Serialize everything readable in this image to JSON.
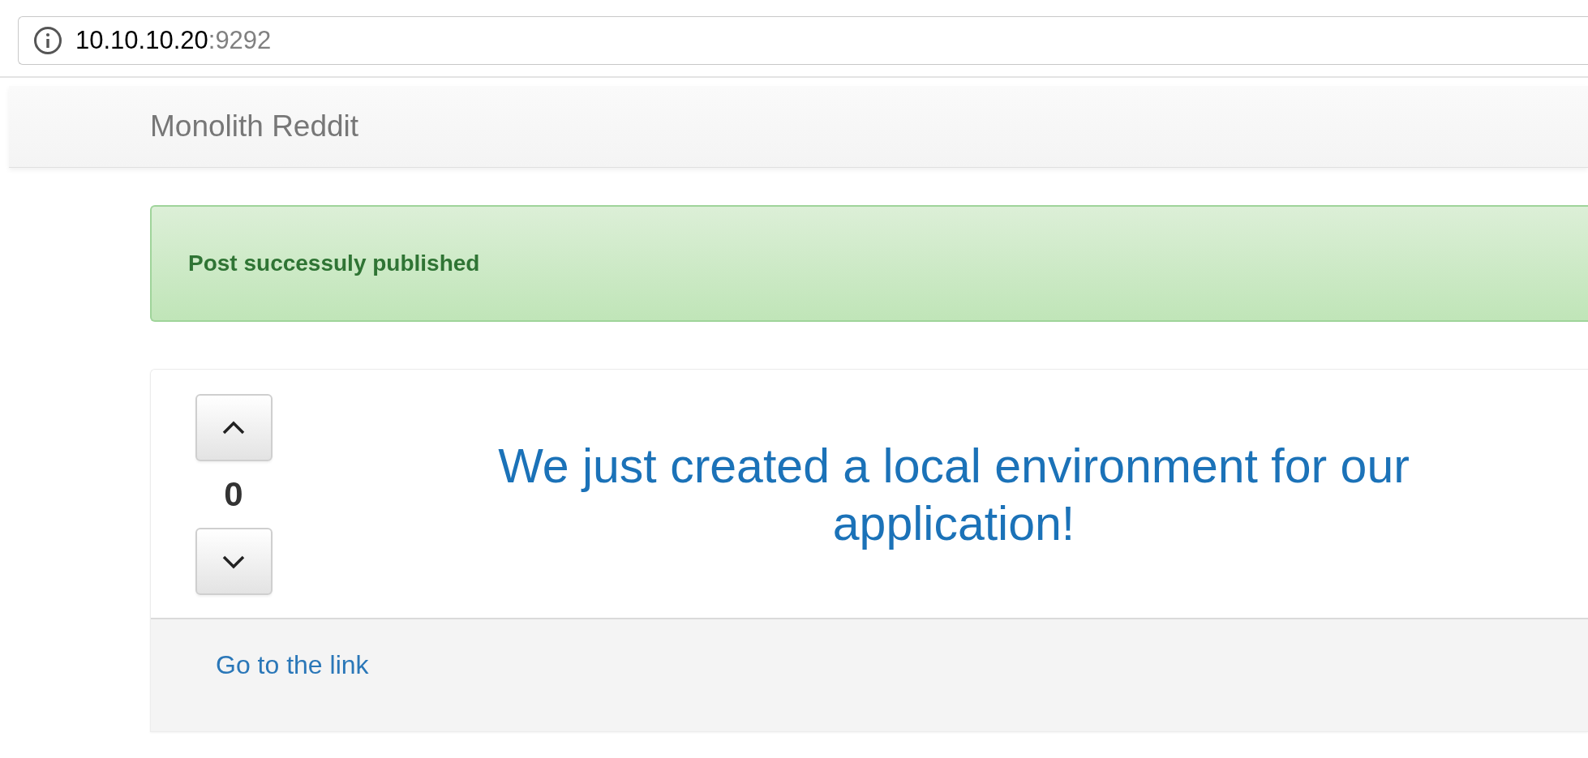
{
  "address_bar": {
    "host": "10.10.10.20",
    "port": ":9292"
  },
  "navbar": {
    "brand": "Monolith Reddit"
  },
  "alert": {
    "message": "Post successuly published"
  },
  "post": {
    "score": "0",
    "title": "We just created a local environment for our application!",
    "link": "Go to the link"
  }
}
